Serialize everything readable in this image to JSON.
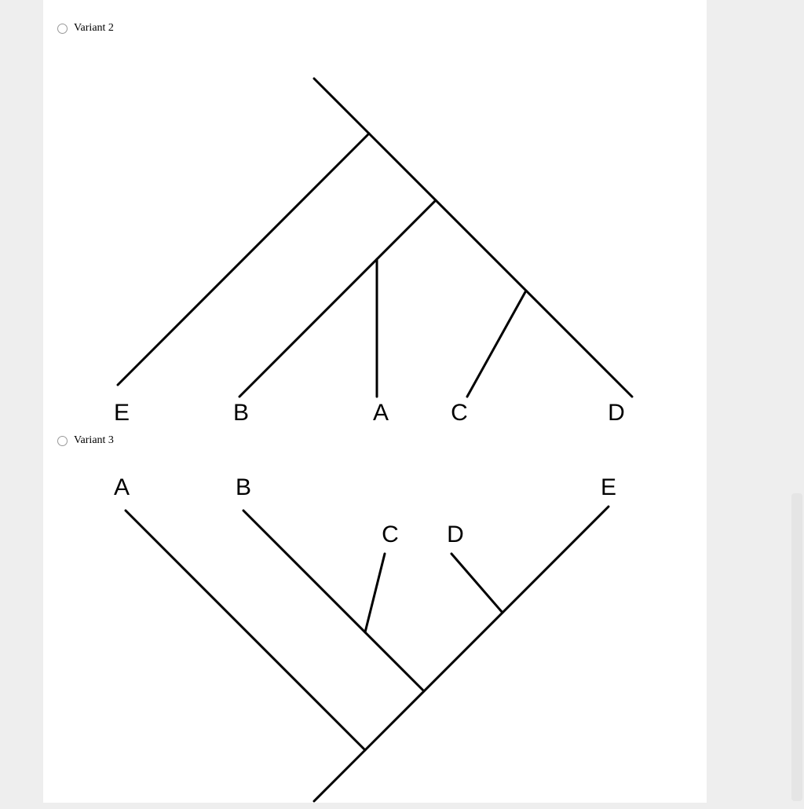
{
  "options": [
    {
      "label": "Variant 2"
    },
    {
      "label": "Variant 3"
    }
  ],
  "tree2": {
    "leaves": {
      "E": "E",
      "B": "B",
      "A": "A",
      "C": "C",
      "D": "D"
    }
  },
  "tree3": {
    "leaves": {
      "A": "A",
      "B": "B",
      "C": "C",
      "D": "D",
      "E": "E"
    }
  }
}
